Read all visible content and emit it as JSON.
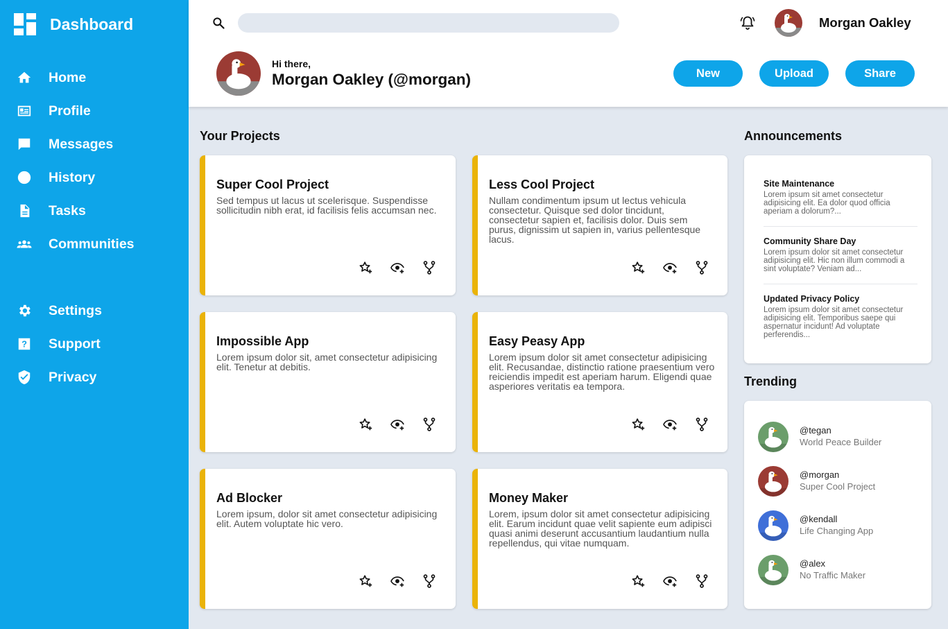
{
  "sidebar": {
    "title": "Dashboard",
    "items": [
      {
        "label": "Home",
        "icon": "home-icon"
      },
      {
        "label": "Profile",
        "icon": "id-card-icon"
      },
      {
        "label": "Messages",
        "icon": "message-icon"
      },
      {
        "label": "History",
        "icon": "clock-icon"
      },
      {
        "label": "Tasks",
        "icon": "document-icon"
      },
      {
        "label": "Communities",
        "icon": "group-icon"
      },
      {
        "label": "Settings",
        "icon": "gear-icon"
      },
      {
        "label": "Support",
        "icon": "help-icon"
      },
      {
        "label": "Privacy",
        "icon": "shield-icon"
      }
    ]
  },
  "header": {
    "user_name": "Morgan Oakley",
    "greeting": "Hi there,",
    "full_name": "Morgan Oakley (@morgan)",
    "buttons": {
      "new": "New",
      "upload": "Upload",
      "share": "Share"
    },
    "search": {
      "placeholder": ""
    }
  },
  "projects": {
    "title": "Your Projects",
    "items": [
      {
        "title": "Super Cool Project",
        "desc": "Sed tempus ut lacus ut scelerisque. Suspendisse sollicitudin nibh erat, id facilisis felis accumsan nec."
      },
      {
        "title": "Less Cool Project",
        "desc": "Nullam condimentum ipsum ut lectus vehicula consectetur. Quisque sed dolor tincidunt, consectetur sapien et, facilisis dolor. Duis sem purus, dignissim ut sapien in, varius pellentesque lacus."
      },
      {
        "title": "Impossible App",
        "desc": "Lorem ipsum dolor sit, amet consectetur adipisicing elit. Tenetur at debitis."
      },
      {
        "title": "Easy Peasy App",
        "desc": "Lorem ipsum dolor sit amet consectetur adipisicing elit. Recusandae, distinctio ratione praesentium vero reiciendis impedit est aperiam harum. Eligendi quae asperiores veritatis ea tempora."
      },
      {
        "title": "Ad Blocker",
        "desc": "Lorem ipsum, dolor sit amet consectetur adipisicing elit. Autem voluptate hic vero."
      },
      {
        "title": "Money Maker",
        "desc": "Lorem, ipsum dolor sit amet consectetur adipisicing elit. Earum incidunt quae velit sapiente eum adipisci quasi animi deserunt accusantium laudantium nulla repellendus, qui vitae numquam."
      }
    ]
  },
  "announcements": {
    "title": "Announcements",
    "items": [
      {
        "title": "Site Maintenance",
        "desc": "Lorem ipsum sit amet consectetur adipisicing elit. Ea dolor quod officia aperiam a dolorum?..."
      },
      {
        "title": "Community Share Day",
        "desc": "Lorem ipsum dolor sit amet consectetur adipisicing elit. Hic non illum commodi a sint voluptate? Veniam ad..."
      },
      {
        "title": "Updated Privacy Policy",
        "desc": "Lorem ipsum dolor sit amet consectetur adipisicing elit. Temporibus saepe qui aspernatur incidunt! Ad voluptate perferendis..."
      }
    ]
  },
  "trending": {
    "title": "Trending",
    "items": [
      {
        "handle": "@tegan",
        "project": "World Peace Builder",
        "avatar_bg": "#6b9e6b"
      },
      {
        "handle": "@morgan",
        "project": "Super Cool Project",
        "avatar_bg": "#9b3b34"
      },
      {
        "handle": "@kendall",
        "project": "Life Changing App",
        "avatar_bg": "#3f6fd8"
      },
      {
        "handle": "@alex",
        "project": "No Traffic Maker",
        "avatar_bg": "#6b9e6b"
      }
    ]
  },
  "colors": {
    "accent": "#0ea5e9",
    "card_border": "#eab308",
    "background": "#e2e8f0"
  }
}
